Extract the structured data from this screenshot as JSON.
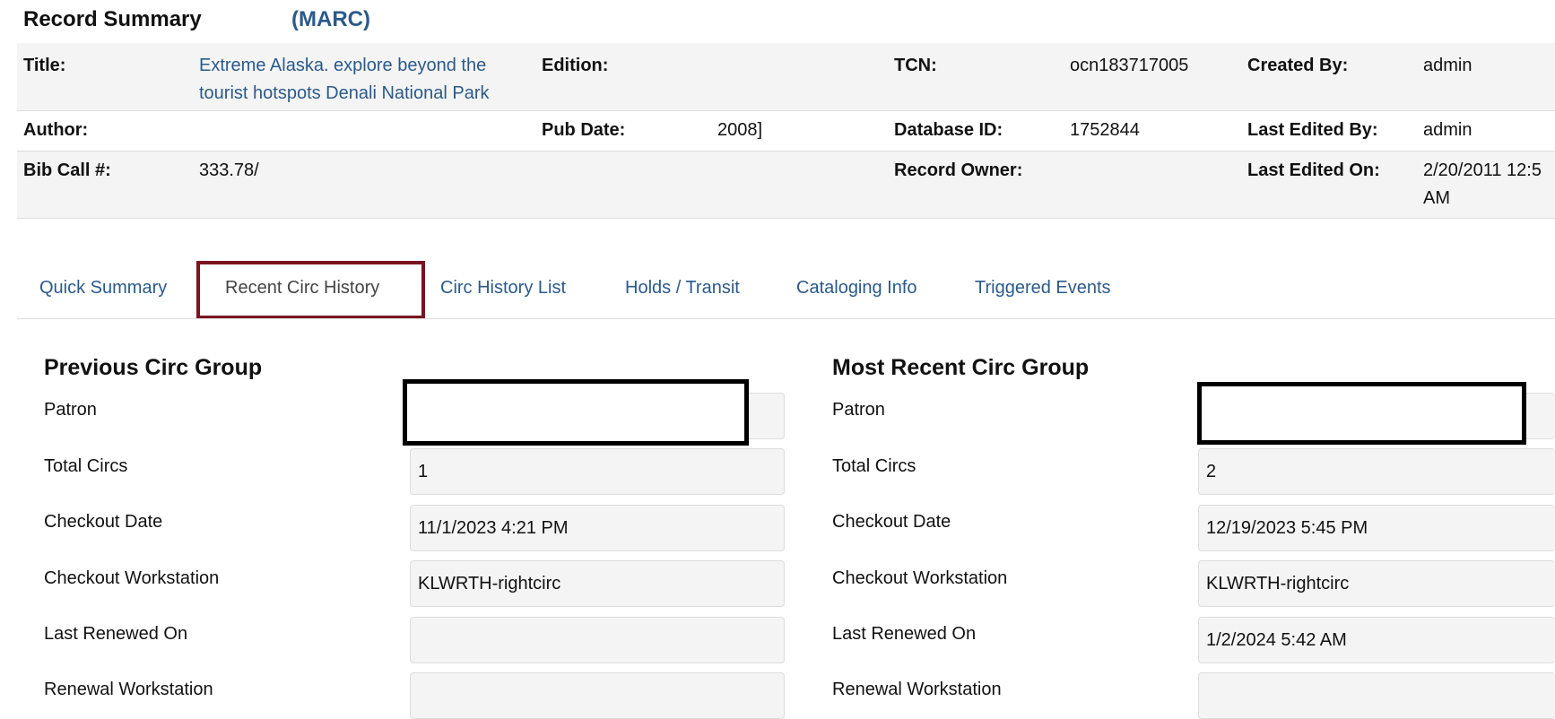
{
  "header": {
    "title": "Record Summary",
    "marc_link": "(MARC)"
  },
  "summary": {
    "title_label": "Title:",
    "title_value_line1": "Extreme Alaska. explore beyond the",
    "title_value_line2": "tourist hotspots Denali National Park",
    "edition_label": "Edition:",
    "tcn_label": "TCN:",
    "tcn_value": "ocn183717005",
    "created_by_label": "Created By:",
    "created_by_value": "admin",
    "author_label": "Author:",
    "pub_date_label": "Pub Date:",
    "pub_date_value": "2008]",
    "database_id_label": "Database ID:",
    "database_id_value": "1752844",
    "last_edited_by_label": "Last Edited By:",
    "last_edited_by_value": "admin",
    "bib_call_label": "Bib Call #:",
    "bib_call_value": "333.78/",
    "record_owner_label": "Record Owner:",
    "last_edited_on_label": "Last Edited On:",
    "last_edited_on_value_line1": "2/20/2011 12:5",
    "last_edited_on_value_line2": "AM"
  },
  "tabs": [
    {
      "label": "Quick Summary"
    },
    {
      "label": "Recent Circ History"
    },
    {
      "label": "Circ History List"
    },
    {
      "label": "Holds / Transit"
    },
    {
      "label": "Cataloging Info"
    },
    {
      "label": "Triggered Events"
    }
  ],
  "previous_group": {
    "title": "Previous Circ Group",
    "fields": [
      {
        "label": "Patron",
        "value": ""
      },
      {
        "label": "Total Circs",
        "value": "1"
      },
      {
        "label": "Checkout Date",
        "value": "11/1/2023 4:21 PM"
      },
      {
        "label": "Checkout Workstation",
        "value": "KLWRTH-rightcirc"
      },
      {
        "label": "Last Renewed On",
        "value": ""
      },
      {
        "label": "Renewal Workstation",
        "value": ""
      }
    ]
  },
  "recent_group": {
    "title": "Most Recent Circ Group",
    "fields": [
      {
        "label": "Patron",
        "value": ""
      },
      {
        "label": "Total Circs",
        "value": "2"
      },
      {
        "label": "Checkout Date",
        "value": "12/19/2023 5:45 PM"
      },
      {
        "label": "Checkout Workstation",
        "value": "KLWRTH-rightcirc"
      },
      {
        "label": "Last Renewed On",
        "value": "1/2/2024 5:42 AM"
      },
      {
        "label": "Renewal Workstation",
        "value": ""
      }
    ]
  }
}
